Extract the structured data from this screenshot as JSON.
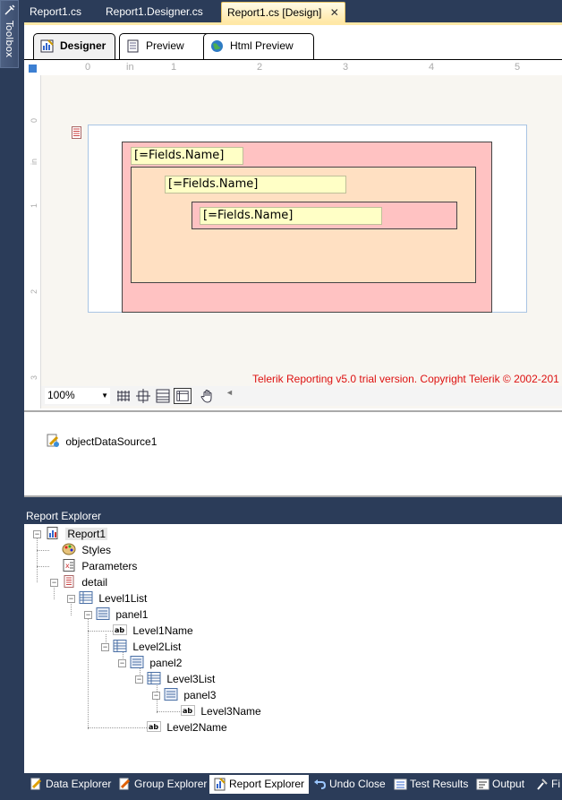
{
  "toolbox": {
    "label": "Toolbox"
  },
  "document_tabs": [
    {
      "label": "Report1.cs"
    },
    {
      "label": "Report1.Designer.cs"
    },
    {
      "label": "Report1.cs [Design]"
    }
  ],
  "view_tabs": [
    {
      "label": "Designer"
    },
    {
      "label": "Preview"
    },
    {
      "label": "Html Preview"
    }
  ],
  "ruler": {
    "unit": "in",
    "top_numbers": [
      "0",
      "1",
      "2",
      "3",
      "4",
      "5"
    ],
    "left_numbers": [
      "0",
      "in",
      "1",
      "2",
      "3"
    ]
  },
  "report_items": {
    "level1_field": "[=Fields.Name]",
    "level2_field": "[=Fields.Name]",
    "level3_field": "[=Fields.Name]"
  },
  "trial_notice": "Telerik Reporting v5.0 trial version. Copyright Telerik © 2002-201",
  "zoom": {
    "value": "100%"
  },
  "component_tray": {
    "data_source": "objectDataSource1"
  },
  "report_explorer": {
    "title": "Report Explorer",
    "nodes": [
      {
        "label": "Report1"
      },
      {
        "label": "Styles"
      },
      {
        "label": "Parameters"
      },
      {
        "label": "detail"
      },
      {
        "label": "Level1List"
      },
      {
        "label": "panel1"
      },
      {
        "label": "Level1Name"
      },
      {
        "label": "Level2List"
      },
      {
        "label": "panel2"
      },
      {
        "label": "Level3List"
      },
      {
        "label": "panel3"
      },
      {
        "label": "Level3Name"
      },
      {
        "label": "Level2Name"
      }
    ]
  },
  "bottom_tabs": [
    {
      "label": "Data Explorer"
    },
    {
      "label": "Group Explorer"
    },
    {
      "label": "Report Explorer"
    },
    {
      "label": "Undo Close"
    },
    {
      "label": "Test Results"
    },
    {
      "label": "Output"
    },
    {
      "label": "Fi"
    }
  ],
  "colors": {
    "ide_background": "#2b3c59",
    "active_tab": "#ffe8a6",
    "panel_level1": "#ffc2c2",
    "panel_level2": "#ffe0c2",
    "textbox": "#ffffc6",
    "trial_text": "#dd1111"
  }
}
